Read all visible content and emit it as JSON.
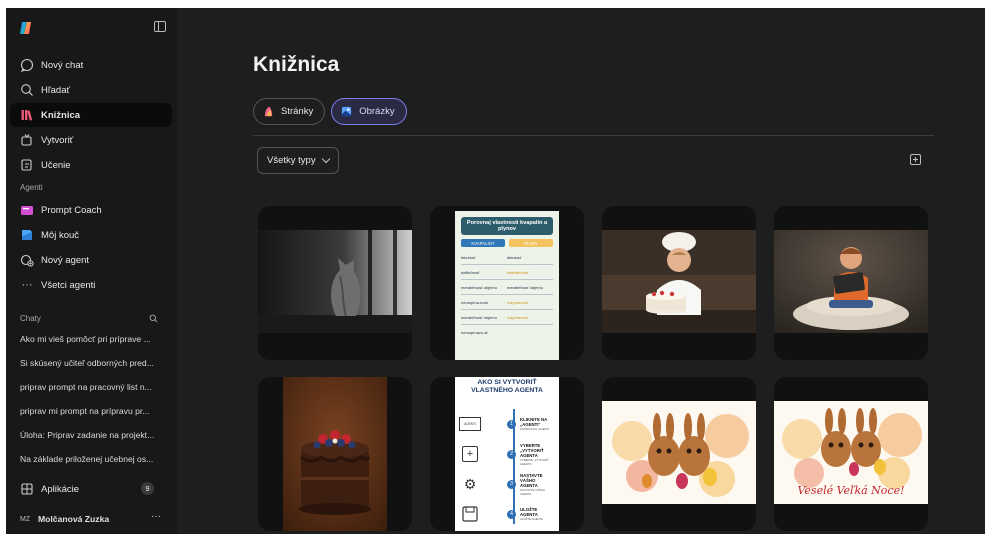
{
  "sidebar": {
    "nav": [
      {
        "label": "Nový chat",
        "icon": "chat-bubble-icon"
      },
      {
        "label": "Hľadať",
        "icon": "search-icon"
      },
      {
        "label": "Knižnica",
        "icon": "library-icon"
      },
      {
        "label": "Vytvoriť",
        "icon": "create-icon"
      },
      {
        "label": "Učenie",
        "icon": "learning-icon"
      }
    ],
    "agents_label": "Agenti",
    "agents": [
      {
        "label": "Prompt Coach",
        "icon": "prompt-coach-icon"
      },
      {
        "label": "Môj kouč",
        "icon": "my-coach-icon"
      },
      {
        "label": "Nový agent",
        "icon": "new-agent-icon"
      },
      {
        "label": "Všetci agenti",
        "icon": "more-icon"
      }
    ],
    "chats_label": "Chaty",
    "chats": [
      "Ako mi vieš pomôcť pri príprave ...",
      "Si skúsený učiteľ odborných pred...",
      "priprav prompt na pracovný list n...",
      "priprav mi prompt na prípravu pr...",
      "Úloha: Priprav zadanie na projekt...",
      "Na základe priloženej učebnej os..."
    ],
    "apps_label": "Aplikácie",
    "apps_count": "9",
    "user_initials": "MZ",
    "user_name": "Molčanová Zuzka",
    "more": "···"
  },
  "main": {
    "title": "Knižnica",
    "tabs": [
      {
        "label": "Stránky",
        "selected": false
      },
      {
        "label": "Obrázky",
        "selected": true
      }
    ],
    "filter_label": "Všetky typy",
    "images": [
      {
        "name": "cat-window",
        "desc": "Čiernobiela mačka pri okne"
      },
      {
        "name": "infographic-liquids-gases"
      },
      {
        "name": "chef-cake"
      },
      {
        "name": "boy-tablet"
      },
      {
        "name": "chocolate-cake"
      },
      {
        "name": "infographic-agent"
      },
      {
        "name": "easter-bunnies"
      },
      {
        "name": "easter-bunnies-greeting"
      }
    ]
  },
  "infographic1": {
    "title": "Porovnaj vlastnosti kvapalín a plynov",
    "col_left": "KVAPALINY",
    "col_right": "PLYNY",
    "rows": [
      [
        "tekutosť",
        "tekutosť"
      ],
      [
        "deliteľnosť",
        "stlačiteľnosť"
      ],
      [
        "merateľnosť objemu",
        "merateľnosť objemu"
      ],
      [
        "nerozpína-nosť",
        "rozpínavosť"
      ],
      [
        "merateľnosť objemu",
        "rozpínavosť"
      ],
      [
        "nerozpínavo-sť",
        ""
      ]
    ]
  },
  "infographic2": {
    "title": "AKO SI VYTVORIŤ VLASTNÉHO AGENTA",
    "steps": [
      {
        "n": "1",
        "head": "KLIKNITE NA „AGENTI“",
        "sub": "KLIKNITE NA „AGENTI“",
        "icon_text": "AGENTI"
      },
      {
        "n": "2",
        "head": "VYBERTE „VYTVORIŤ AGENTA",
        "sub": "VYBERTE „VYTVORIŤ AGENTA"
      },
      {
        "n": "3",
        "head": "NASTAVTE VÁŠHO AGENTA",
        "sub": "NASTAVTE VÁŠHO AGENTA"
      },
      {
        "n": "4",
        "head": "ULOŽTE AGENTA",
        "sub": "ULOŽTE AGENTA"
      }
    ]
  },
  "greeting": "Veselé Veľká Noce!",
  "colors": {
    "accent": "#7b7ff0",
    "sidebar_bg": "#181818",
    "main_bg": "#1e1e1e",
    "card_bg": "#111111"
  }
}
